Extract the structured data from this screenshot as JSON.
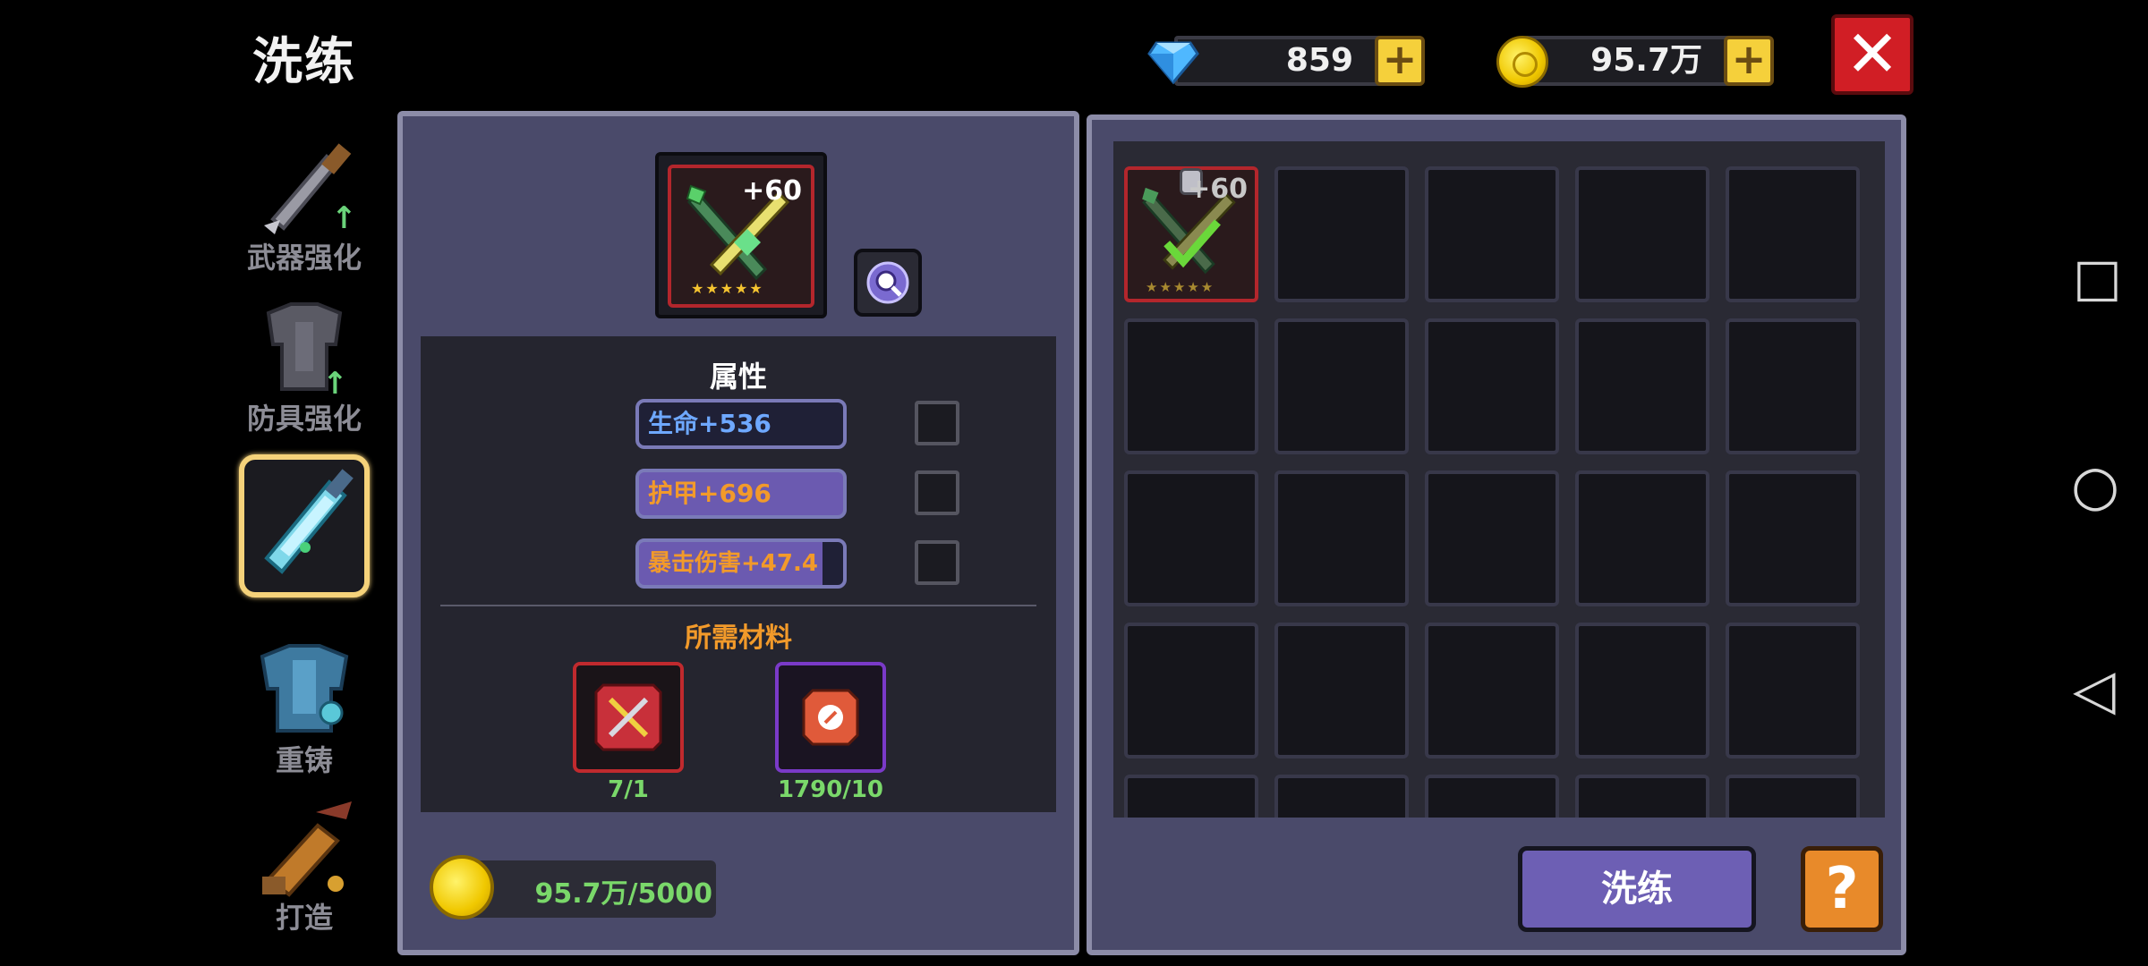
{
  "screen": {
    "title": "洗练"
  },
  "currency": {
    "gems": "859",
    "coins": "95.7万",
    "gem_color": "#4fb8ff",
    "coin_color": "#f5d03b"
  },
  "nav": {
    "items": [
      {
        "label": "武器强化",
        "icon": "sword-upgrade-icon",
        "active": false
      },
      {
        "label": "防具强化",
        "icon": "armor-upgrade-icon",
        "active": false
      },
      {
        "label": "洗练",
        "icon": "crystal-sword-icon",
        "active": true
      },
      {
        "label": "重铸",
        "icon": "recast-armor-icon",
        "active": false
      },
      {
        "label": "打造",
        "icon": "forge-hammer-icon",
        "active": false
      }
    ]
  },
  "equipment": {
    "level": "+60",
    "stars": "★★★★★"
  },
  "attributes": {
    "header": "属性",
    "items": [
      {
        "text": "生命+536",
        "color": "#6ea8ff"
      },
      {
        "text": "护甲+696",
        "color": "#f29a2a"
      },
      {
        "text": "暴击伤害+47.4",
        "color": "#f29a2a"
      }
    ]
  },
  "materials": {
    "header": "所需材料",
    "items": [
      {
        "count": "7/1",
        "border": "#c02a2e"
      },
      {
        "count": "1790/10",
        "border": "#7a3ac8"
      }
    ]
  },
  "cost": {
    "text": "95.7万/5000"
  },
  "inventory": {
    "first_item_level": "+60",
    "first_item_stars": "★★★★★"
  },
  "actions": {
    "refine_label": "洗练",
    "help_label": "?",
    "close_label": "✕"
  },
  "system_nav": {
    "recent": "□",
    "home": "○",
    "back": "◁"
  }
}
